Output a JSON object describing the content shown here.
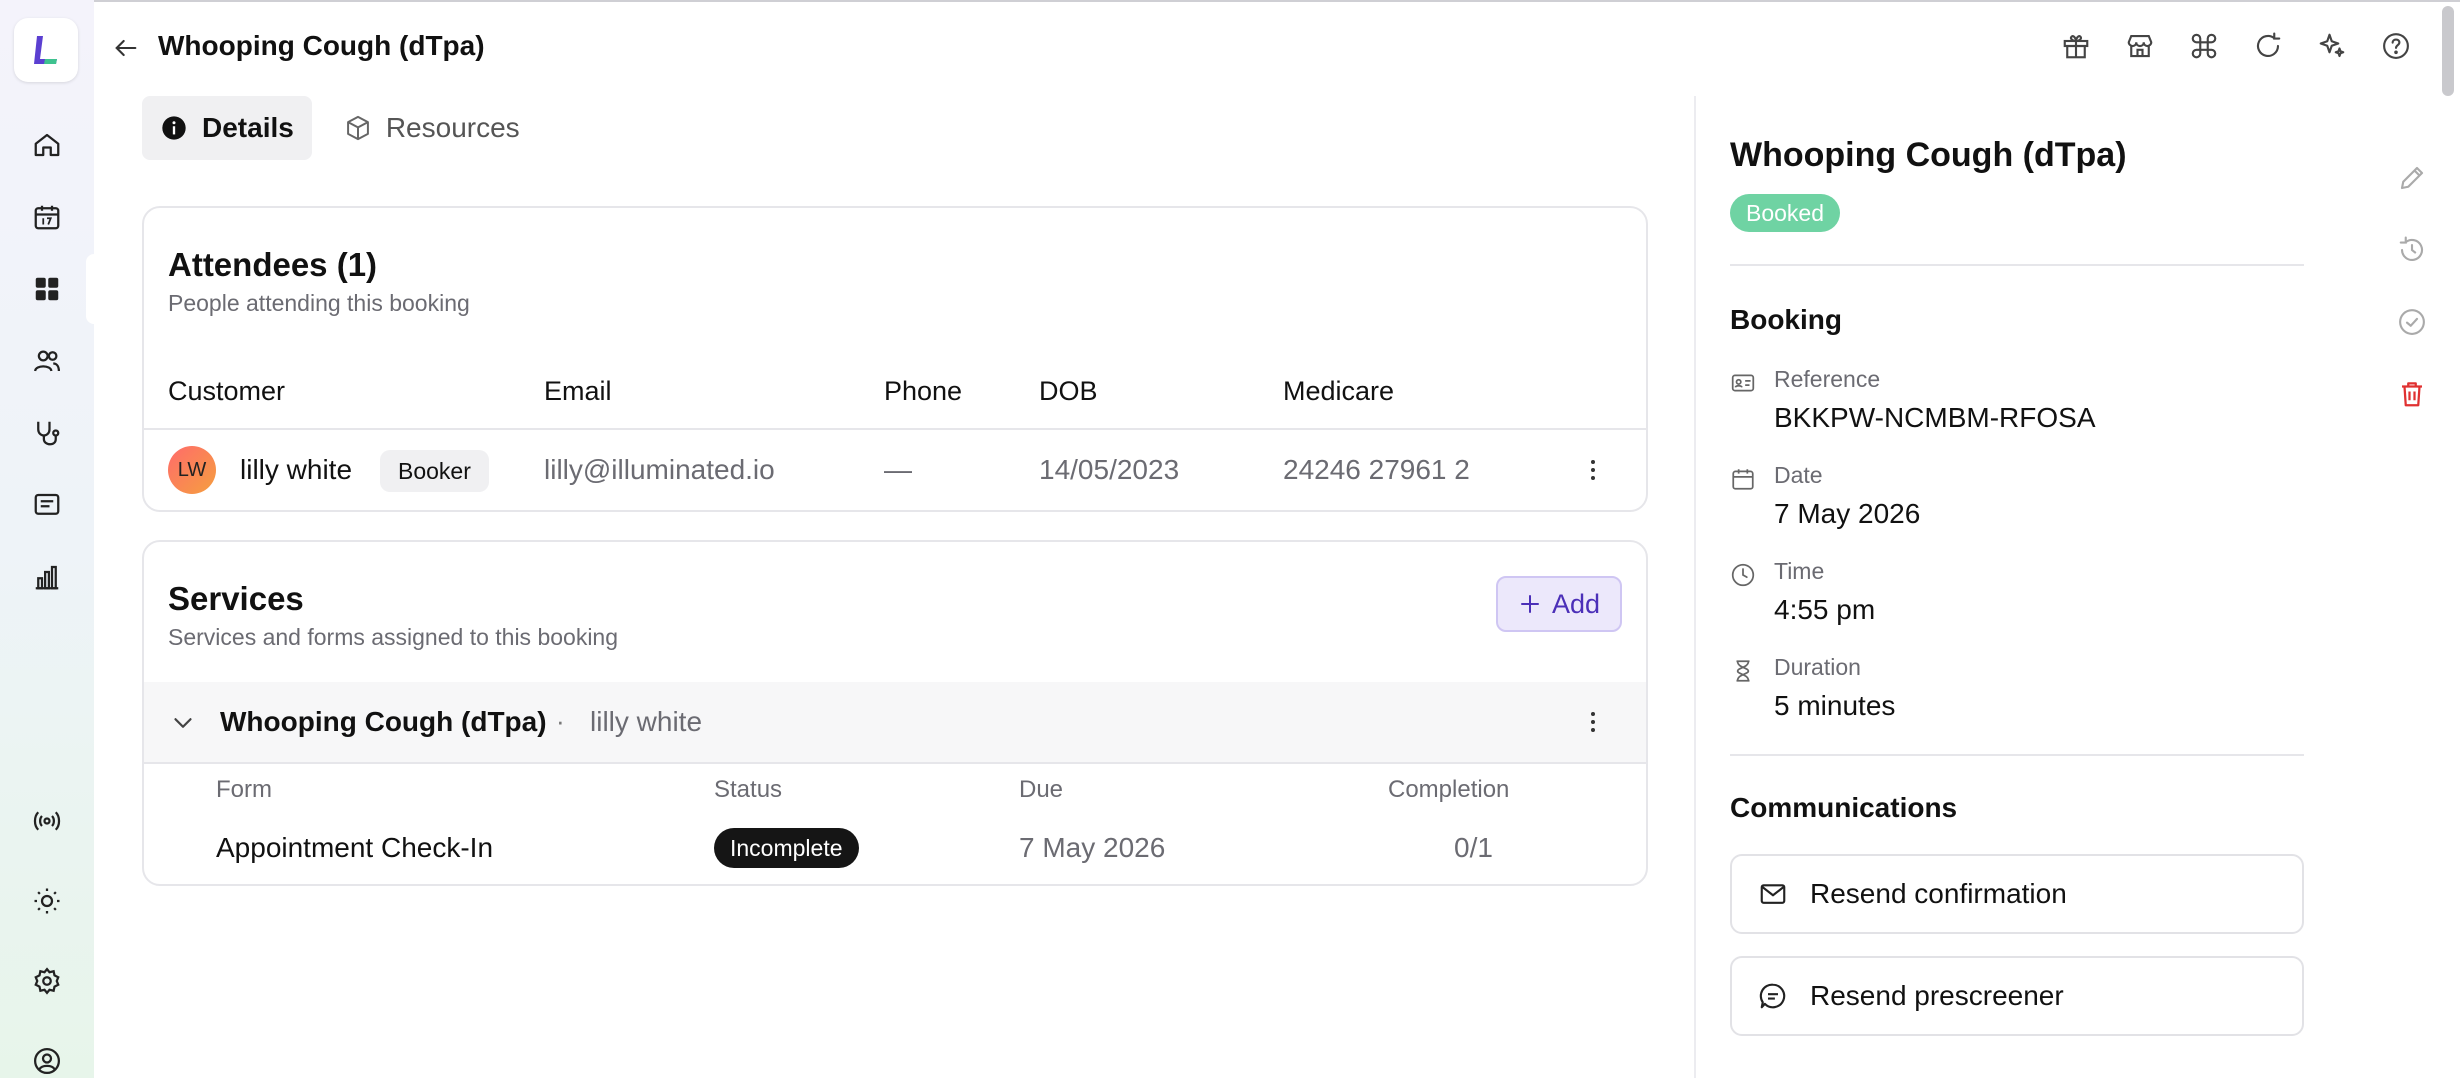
{
  "header": {
    "title": "Whooping Cough (dTpa)",
    "icons": [
      "gift-icon",
      "store-icon",
      "command-icon",
      "refresh-icon",
      "sparkles-icon",
      "help-icon"
    ]
  },
  "sidebar": {
    "items": [
      "home-icon",
      "calendar-icon",
      "dashboard-icon",
      "people-icon",
      "stethoscope-icon",
      "messages-icon",
      "reports-icon"
    ],
    "bottom_items": [
      "broadcast-icon",
      "theme-icon",
      "settings-icon",
      "profile-icon"
    ]
  },
  "tabs": [
    {
      "label": "Details",
      "active": true
    },
    {
      "label": "Resources",
      "active": false
    }
  ],
  "attendees": {
    "title": "Attendees (1)",
    "subtitle": "People attending this booking",
    "columns": [
      "Customer",
      "Email",
      "Phone",
      "DOB",
      "Medicare"
    ],
    "rows": [
      {
        "initials": "LW",
        "name": "lilly white",
        "role": "Booker",
        "email": "lilly@illuminated.io",
        "phone": "—",
        "dob": "14/05/2023",
        "medicare": "24246 27961 2"
      }
    ]
  },
  "services": {
    "title": "Services",
    "subtitle": "Services and forms assigned to this booking",
    "add_label": "Add",
    "service": {
      "name": "Whooping Cough (dTpa)",
      "separator": "·",
      "attendee": "lilly white"
    },
    "form_columns": [
      "Form",
      "Status",
      "Due",
      "Completion"
    ],
    "forms": [
      {
        "form": "Appointment Check-In",
        "status": "Incomplete",
        "due": "7 May 2026",
        "completion": "0/1"
      }
    ]
  },
  "panel": {
    "title": "Whooping Cough (dTpa)",
    "status": "Booked",
    "booking_heading": "Booking",
    "fields": [
      {
        "label": "Reference",
        "value": "BKKPW-NCMBM-RFOSA",
        "icon": "id-card-icon"
      },
      {
        "label": "Date",
        "value": "7 May 2026",
        "icon": "calendar-icon"
      },
      {
        "label": "Time",
        "value": "4:55 pm",
        "icon": "clock-icon"
      },
      {
        "label": "Duration",
        "value": "5 minutes",
        "icon": "hourglass-icon"
      }
    ],
    "communications_heading": "Communications",
    "resend_confirmation": "Resend confirmation",
    "resend_prescreener": "Resend prescreener"
  },
  "colors": {
    "accent": "#4b2fb8",
    "booked": "#6fd3a3",
    "delete": "#e03131"
  }
}
